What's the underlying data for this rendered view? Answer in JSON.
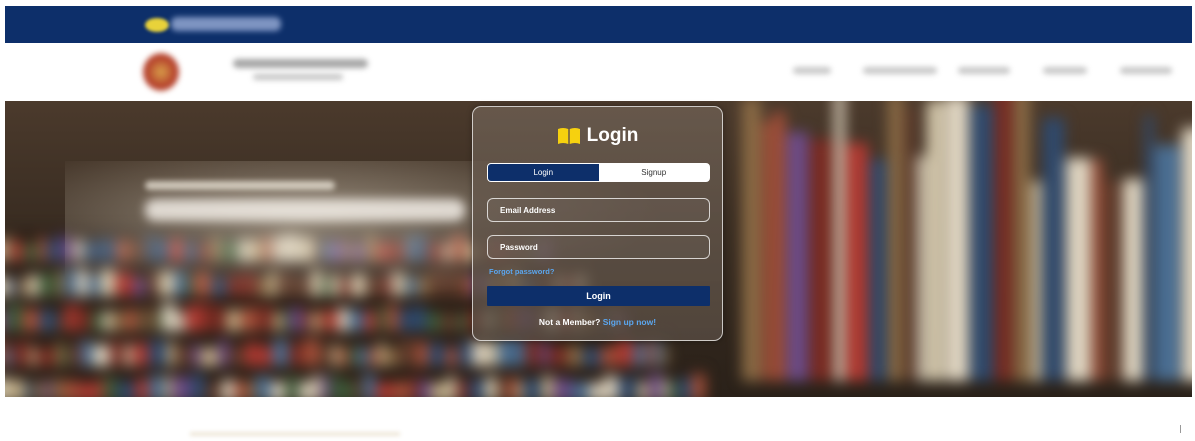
{
  "login_card": {
    "title": "Login",
    "icon": "open-book-icon",
    "tabs": [
      {
        "label": "Login",
        "active": true
      },
      {
        "label": "Signup",
        "active": false
      }
    ],
    "email_placeholder": "Email Address",
    "password_placeholder": "Password",
    "forgot_label": "Forgot password?",
    "submit_label": "Login",
    "member_prompt": "Not a Member?",
    "signup_link": "Sign up now!"
  },
  "colors": {
    "brand_navy": "#0d2f6a",
    "link_blue": "#5ba6ee",
    "icon_yellow": "#f6d10f"
  }
}
